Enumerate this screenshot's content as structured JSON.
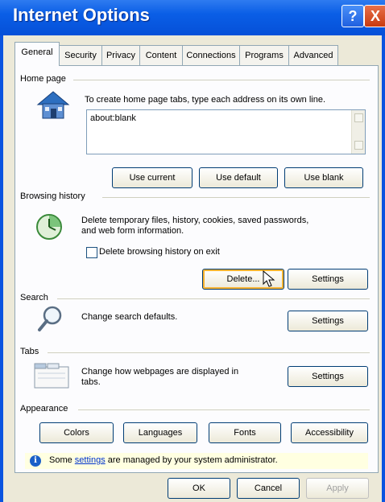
{
  "window": {
    "title": "Internet Options",
    "help_label": "?",
    "close_label": "X"
  },
  "tabs": [
    "General",
    "Security",
    "Privacy",
    "Content",
    "Connections",
    "Programs",
    "Advanced"
  ],
  "home_page": {
    "label": "Home page",
    "description": "To create home page tabs, type each address on its own line.",
    "value": "about:blank",
    "buttons": {
      "use_current": "Use current",
      "use_default": "Use default",
      "use_blank": "Use blank"
    }
  },
  "browsing_history": {
    "label": "Browsing history",
    "description_line1": "Delete temporary files, history, cookies, saved passwords,",
    "description_line2": "and web form information.",
    "checkbox_label": "Delete browsing history on exit",
    "checkbox_checked": false,
    "delete_button": "Delete...",
    "settings_button": "Settings"
  },
  "search": {
    "label": "Search",
    "description": "Change search defaults.",
    "settings_button": "Settings"
  },
  "tabs_section": {
    "label": "Tabs",
    "description_line1": "Change how webpages are displayed in",
    "description_line2": "tabs.",
    "settings_button": "Settings"
  },
  "appearance": {
    "label": "Appearance",
    "buttons": [
      "Colors",
      "Languages",
      "Fonts",
      "Accessibility"
    ]
  },
  "info": {
    "prefix": "Some ",
    "link": "settings",
    "suffix": " are managed by your system administrator."
  },
  "footer": {
    "ok": "OK",
    "cancel": "Cancel",
    "apply": "Apply"
  }
}
